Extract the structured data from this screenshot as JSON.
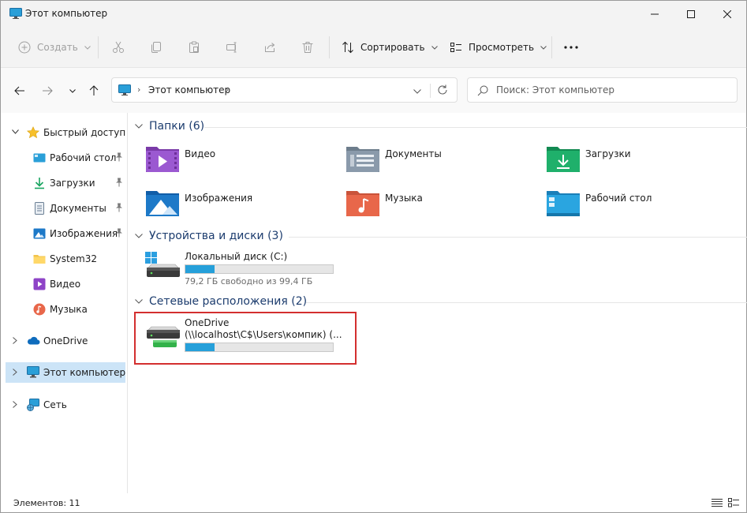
{
  "window": {
    "title": "Этот компьютер",
    "minimize_label": "—",
    "maximize_label": "☐",
    "close_label": "✕"
  },
  "toolbar": {
    "new_label": "Создать",
    "sort_label": "Сортировать",
    "view_label": "Просмотреть",
    "more_label": "···"
  },
  "navigation": {
    "breadcrumb": "Этот компьютер",
    "search_placeholder": "Поиск: Этот компьютер"
  },
  "sidebar": {
    "items": [
      {
        "label": "Быстрый доступ",
        "icon": "star-icon"
      },
      {
        "label": "Рабочий стол",
        "icon": "desktop-icon",
        "pinned": true
      },
      {
        "label": "Загрузки",
        "icon": "download-icon",
        "pinned": true
      },
      {
        "label": "Документы",
        "icon": "documents-icon",
        "pinned": true
      },
      {
        "label": "Изображения",
        "icon": "pictures-icon",
        "pinned": true
      },
      {
        "label": "System32",
        "icon": "folder-icon"
      },
      {
        "label": "Видео",
        "icon": "videos-icon"
      },
      {
        "label": "Музыка",
        "icon": "music-icon"
      },
      {
        "label": "OneDrive",
        "icon": "cloud-icon"
      },
      {
        "label": "Этот компьютер",
        "icon": "computer-icon",
        "selected": true
      },
      {
        "label": "Сеть",
        "icon": "network-icon"
      }
    ]
  },
  "content": {
    "folders_header": "Папки (6)",
    "folders": [
      {
        "name": "Видео",
        "icon": "videos-folder-icon"
      },
      {
        "name": "Документы",
        "icon": "documents-folder-icon"
      },
      {
        "name": "Загрузки",
        "icon": "downloads-folder-icon"
      },
      {
        "name": "Изображения",
        "icon": "pictures-folder-icon"
      },
      {
        "name": "Музыка",
        "icon": "music-folder-icon"
      },
      {
        "name": "Рабочий стол",
        "icon": "desktop-folder-icon"
      }
    ],
    "devices_header": "Устройства и диски (3)",
    "drives": [
      {
        "name": "Локальный диск (C:)",
        "free_text": "79,2 ГБ свободно из 99,4 ГБ",
        "used_fraction": 0.2
      }
    ],
    "network_header": "Сетевые расположения (2)",
    "network": [
      {
        "name": "OneDrive",
        "path": "(\\\\localhost\\C$\\Users\\компик) (...",
        "used_fraction": 0.2
      }
    ]
  },
  "statusbar": {
    "items_count": "Элементов: 11"
  },
  "colors": {
    "accent": "#26a0da",
    "selection": "#cce4f7",
    "highlight_border": "#d32f2f",
    "group_header": "#1c3c6e"
  }
}
